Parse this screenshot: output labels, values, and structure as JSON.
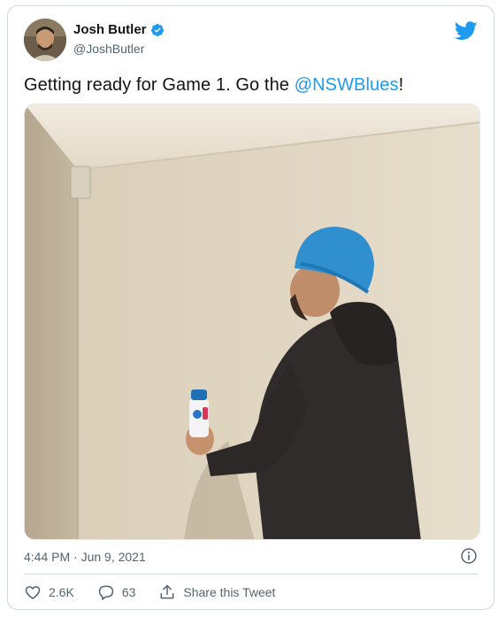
{
  "author": {
    "display_name": "Josh Butler",
    "handle": "@JoshButler",
    "verified": true
  },
  "tweet": {
    "text_before": "Getting ready for Game 1. Go the ",
    "mention": "@NSWBlues",
    "text_after": "!",
    "timestamp": "4:44 PM · Jun 9, 2021"
  },
  "actions": {
    "like_count": "2.6K",
    "reply_count": "63",
    "share_label": "Share this Tweet"
  },
  "icons": {
    "brand": "twitter-bird-icon",
    "verified": "verified-badge-icon",
    "info": "info-icon",
    "like": "heart-icon",
    "reply": "reply-bubble-icon",
    "share": "share-icon"
  },
  "colors": {
    "brand": "#1d9bf0",
    "text": "#0f1419",
    "secondary": "#536471",
    "border": "#cfd9de"
  }
}
